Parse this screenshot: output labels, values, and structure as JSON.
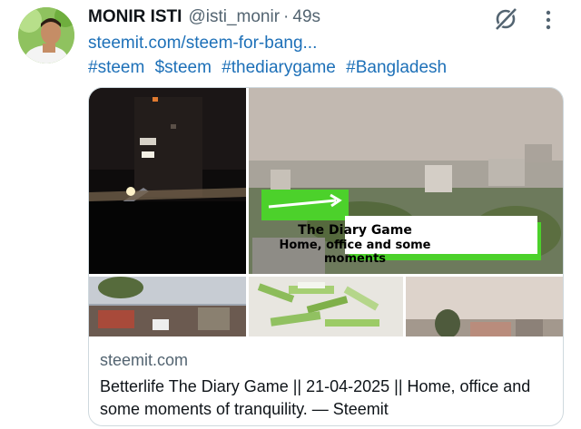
{
  "tweet": {
    "author_name": "MONIR ISTI",
    "author_handle": "@isti_monir",
    "separator": "·",
    "timestamp": "49s",
    "link_text": "steemit.com/steem-for-bang...",
    "hashtags": [
      "#steem",
      "$steem",
      "#thediarygame",
      "#Bangladesh"
    ]
  },
  "card": {
    "domain": "steemit.com",
    "title": "Betterlife The Diary Game || 21-04-2025 || Home, office and some moments of tranquility. — Steemit",
    "image_overlay": {
      "title": "The Diary Game",
      "subtitle": "Home, office and some moments"
    }
  },
  "icons": {
    "grok": "grok-icon",
    "more": "more-icon"
  },
  "colors": {
    "link": "#1d70b8",
    "secondary_text": "#536471",
    "border": "#cfd9de",
    "overlay_green": "#4cd12b"
  }
}
